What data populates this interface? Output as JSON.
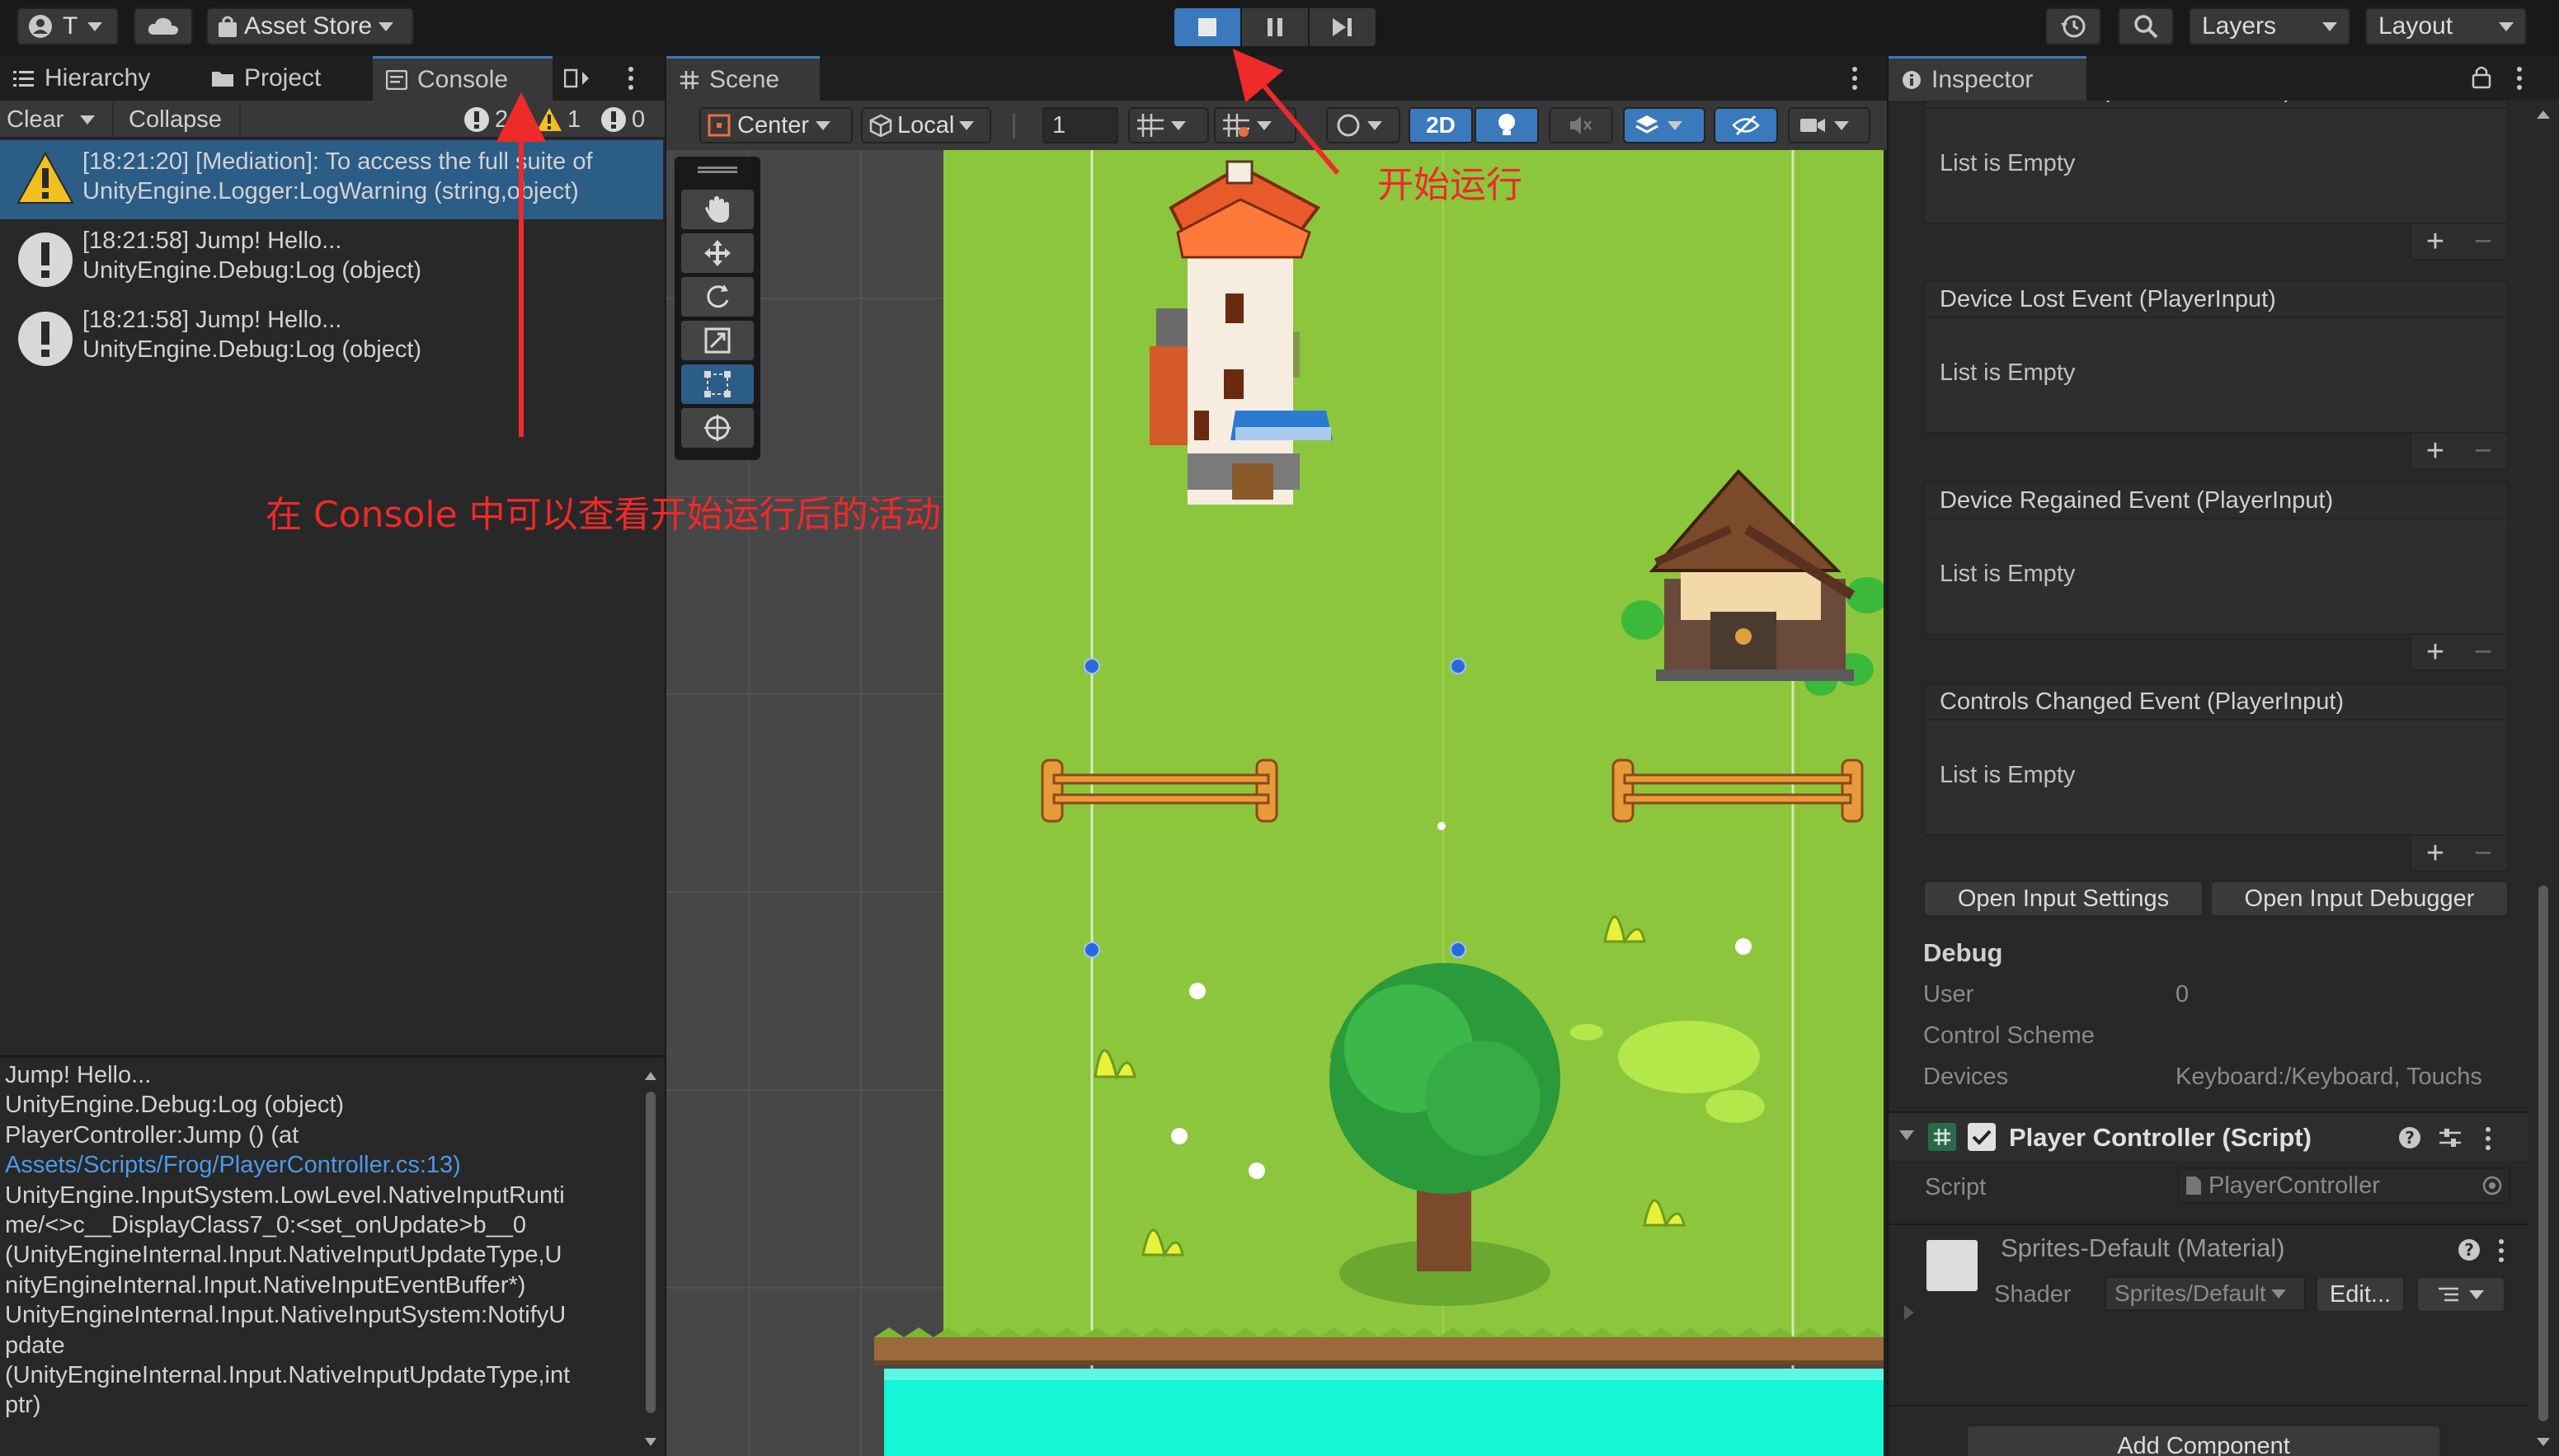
{
  "toolbar": {
    "account_label": "T",
    "asset_store_label": "Asset Store",
    "layers_label": "Layers",
    "layout_label": "Layout"
  },
  "left_panel": {
    "tabs": [
      {
        "label": "Hierarchy",
        "icon": "list-icon"
      },
      {
        "label": "Project",
        "icon": "folder-icon"
      },
      {
        "label": "Console",
        "icon": "console-icon"
      }
    ],
    "console_toolbar": {
      "clear_label": "Clear",
      "collapse_label": "Collapse",
      "error_count": "2",
      "warning_count": "1",
      "info_count": "0"
    },
    "log_entries": [
      {
        "type": "warning",
        "line1": "[18:21:20] [Mediation]: To access the full suite of",
        "line2": "UnityEngine.Logger:LogWarning (string,object)"
      },
      {
        "type": "info",
        "line1": "[18:21:58] Jump! Hello...",
        "line2": "UnityEngine.Debug:Log (object)"
      },
      {
        "type": "info",
        "line1": "[18:21:58] Jump! Hello...",
        "line2": "UnityEngine.Debug:Log (object)"
      }
    ],
    "detail_lines": [
      "Jump! Hello...",
      "UnityEngine.Debug:Log (object)",
      "PlayerController:Jump () (at",
      "Assets/Scripts/Frog/PlayerController.cs:13)",
      "UnityEngine.InputSystem.LowLevel.NativeInputRunti",
      "me/<>c__DisplayClass7_0:<set_onUpdate>b__0",
      "(UnityEngineInternal.Input.NativeInputUpdateType,U",
      "nityEngineInternal.Input.NativeInputEventBuffer*)",
      "UnityEngineInternal.Input.NativeInputSystem:NotifyU",
      "pdate",
      "(UnityEngineInternal.Input.NativeInputUpdateType,int",
      "ptr)"
    ],
    "detail_link_index": 3
  },
  "scene": {
    "tab_label": "Scene",
    "pivot_label": "Center",
    "space_label": "Local",
    "grid_value": "1",
    "mode_2d_label": "2D"
  },
  "inspector": {
    "tab_label": "Inspector",
    "cut_event_label": "Touch Position (CallbackContext)",
    "events": [
      {
        "title": "Device Lost Event (PlayerInput)",
        "body": "List is Empty"
      },
      {
        "title": "Device Regained Event (PlayerInput)",
        "body": "List is Empty"
      },
      {
        "title": "Controls Changed Event (PlayerInput)",
        "body": "List is Empty"
      }
    ],
    "first_body": "List is Empty",
    "open_input_settings": "Open Input Settings",
    "open_input_debugger": "Open Input Debugger",
    "debug": {
      "title": "Debug",
      "user_label": "User",
      "user_value": "0",
      "scheme_label": "Control Scheme",
      "devices_label": "Devices",
      "devices_value": "Keyboard:/Keyboard, Touchs"
    },
    "component": {
      "title": "Player Controller (Script)",
      "script_label": "Script",
      "script_value": "PlayerController"
    },
    "material": {
      "name": "Sprites-Default (Material)",
      "shader_label": "Shader",
      "shader_value": "Sprites/Default",
      "edit_label": "Edit..."
    },
    "add_component_label": "Add Component"
  },
  "annotations": {
    "play_note": "开始运行",
    "console_note": "在 Console 中可以查看开始运行后的活动"
  },
  "colors": {
    "accent": "#3a79bb",
    "annotation_red": "#ee2a2a",
    "grass": "#8cc63c",
    "water": "#14f6d6"
  }
}
